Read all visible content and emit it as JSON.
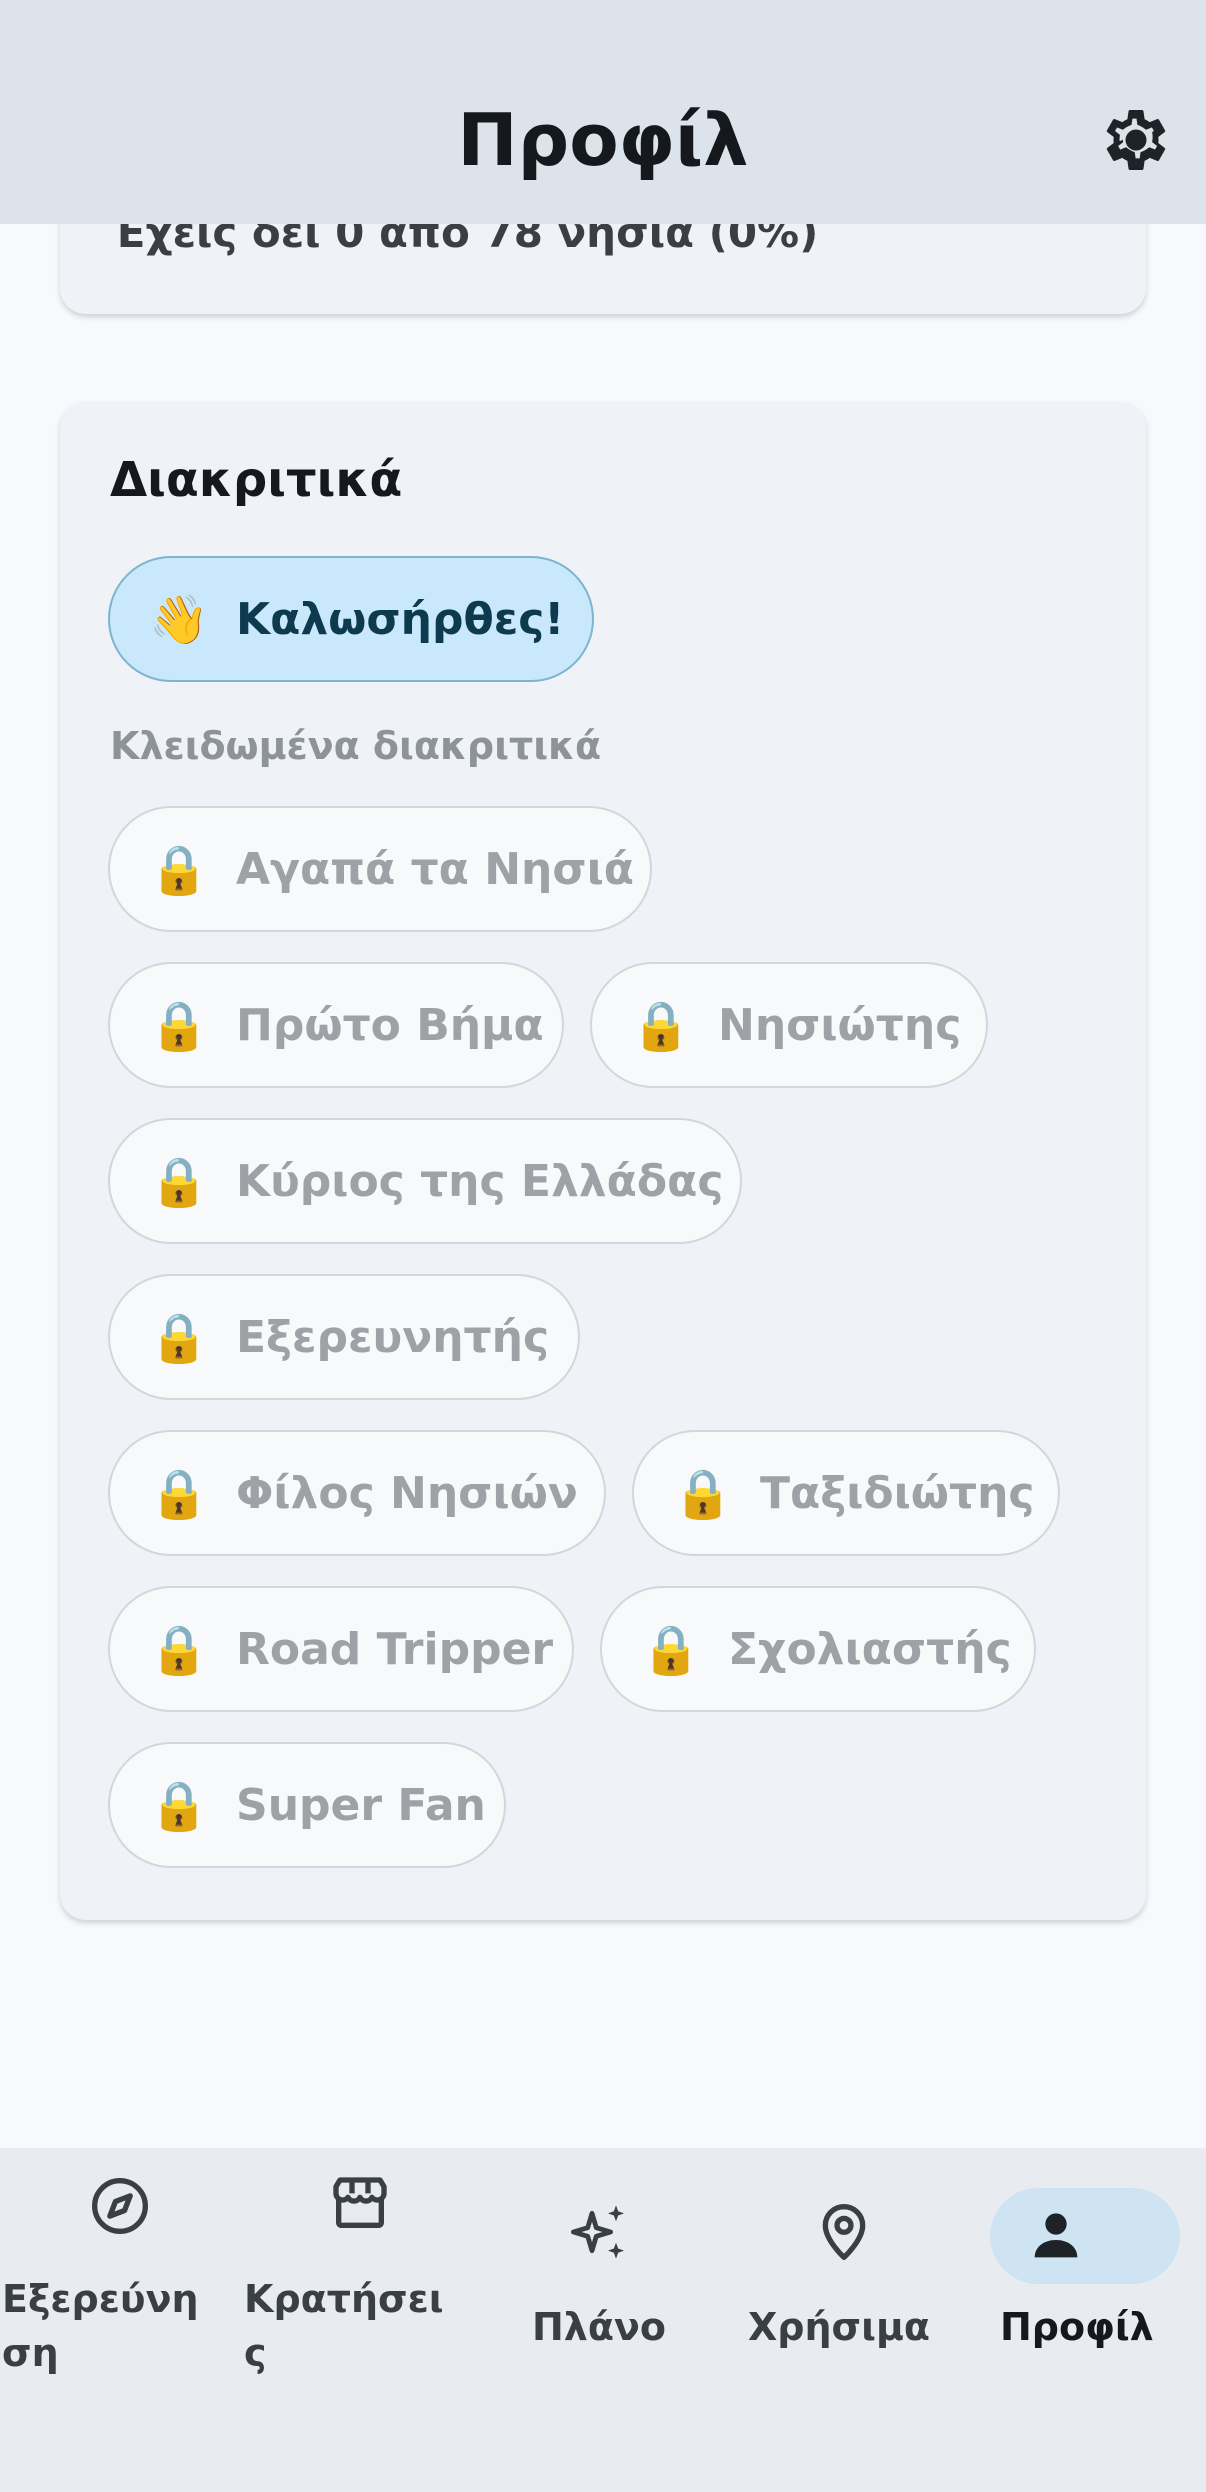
{
  "app_bar": {
    "title": "Προφίλ",
    "settings_icon": "gear-icon"
  },
  "progress_card": {
    "text": "Έχεις δει 0 από 78 νησιά (0%)"
  },
  "badges_card": {
    "title": "Διακριτικά",
    "earned": [
      {
        "icon": "👋",
        "label": "Καλωσήρθες!"
      }
    ],
    "locked_heading": "Κλειδωμένα διακριτικά",
    "locked": [
      {
        "icon": "🔒",
        "label": "Αγαπά τα Νησιά"
      },
      {
        "icon": "🔒",
        "label": "Πρώτο Βήμα"
      },
      {
        "icon": "🔒",
        "label": "Νησιώτης"
      },
      {
        "icon": "🔒",
        "label": "Κύριος της Ελλάδας"
      },
      {
        "icon": "🔒",
        "label": "Εξερευνητής"
      },
      {
        "icon": "🔒",
        "label": "Φίλος Νησιών"
      },
      {
        "icon": "🔒",
        "label": "Ταξιδιώτης"
      },
      {
        "icon": "🔒",
        "label": "Road Tripper"
      },
      {
        "icon": "🔒",
        "label": "Σχολιαστής"
      },
      {
        "icon": "🔒",
        "label": "Super Fan"
      }
    ]
  },
  "bottom_nav": {
    "items": [
      {
        "label_line1": "Εξερεύνη",
        "label_line2": "ση",
        "icon": "compass-icon",
        "active": false
      },
      {
        "label_line1": "Κρατήσει",
        "label_line2": "ς",
        "icon": "store-icon",
        "active": false
      },
      {
        "label_line1": "Πλάνο",
        "icon": "sparkles-icon",
        "active": false
      },
      {
        "label_line1": "Χρήσιμα",
        "icon": "map-pin-icon",
        "active": false
      },
      {
        "label_line1": "Προφίλ",
        "icon": "person-icon",
        "active": true
      }
    ]
  },
  "colors": {
    "accent_chip_bg": "#c9e8fb",
    "accent_chip_text": "#0d3a4f",
    "active_nav_pill": "#cfe4f2",
    "app_bar_bg": "#dde3ea"
  }
}
